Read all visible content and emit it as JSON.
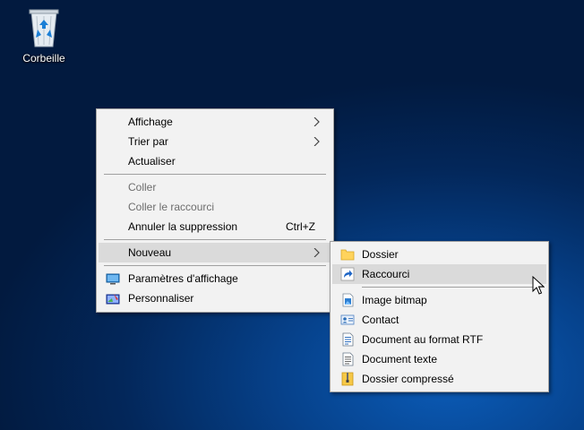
{
  "desktop": {
    "recycle_bin_label": "Corbeille"
  },
  "context_menu": {
    "display": "Affichage",
    "sort_by": "Trier par",
    "refresh": "Actualiser",
    "paste": "Coller",
    "paste_shortcut": "Coller le raccourci",
    "undo_delete": "Annuler la suppression",
    "undo_delete_key": "Ctrl+Z",
    "new": "Nouveau",
    "display_settings": "Paramètres d'affichage",
    "personalize": "Personnaliser"
  },
  "new_submenu": {
    "folder": "Dossier",
    "shortcut": "Raccourci",
    "bitmap": "Image bitmap",
    "contact": "Contact",
    "rtf": "Document au format RTF",
    "text": "Document texte",
    "zip": "Dossier compressé"
  },
  "colors": {
    "menu_bg": "#f2f2f2",
    "highlight": "#dadada",
    "disabled_text": "#6d6d6d"
  }
}
